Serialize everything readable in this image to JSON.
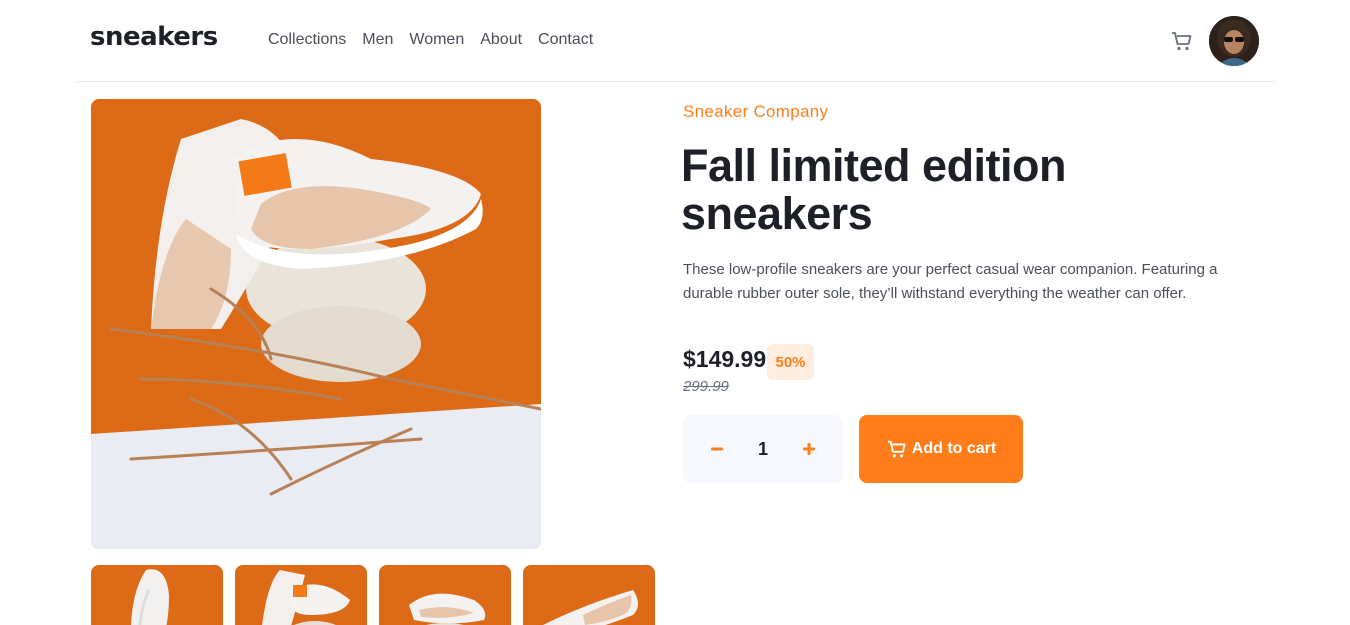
{
  "header": {
    "logo": "sneakers",
    "nav": [
      "Collections",
      "Men",
      "Women",
      "About",
      "Contact"
    ]
  },
  "product": {
    "company": "Sneaker Company",
    "title": "Fall limited edition sneakers",
    "description": "These low-profile sneakers are your perfect casual wear companion. Featuring a durable rubber outer sole, they’ll withstand everything the weather can offer.",
    "price": "$149.99",
    "discount": "50%",
    "original_price": "299.99",
    "quantity": "1",
    "add_to_cart_label": "Add to cart"
  },
  "colors": {
    "accent": "#ff7e1b",
    "accent_light": "#ffede0",
    "dark": "#1d2026",
    "text": "#4b4f58",
    "grey": "#69707d",
    "qty_bg": "#f6f8fd"
  },
  "icons": {
    "cart": "cart-icon",
    "minus": "minus-icon",
    "plus": "plus-icon"
  }
}
